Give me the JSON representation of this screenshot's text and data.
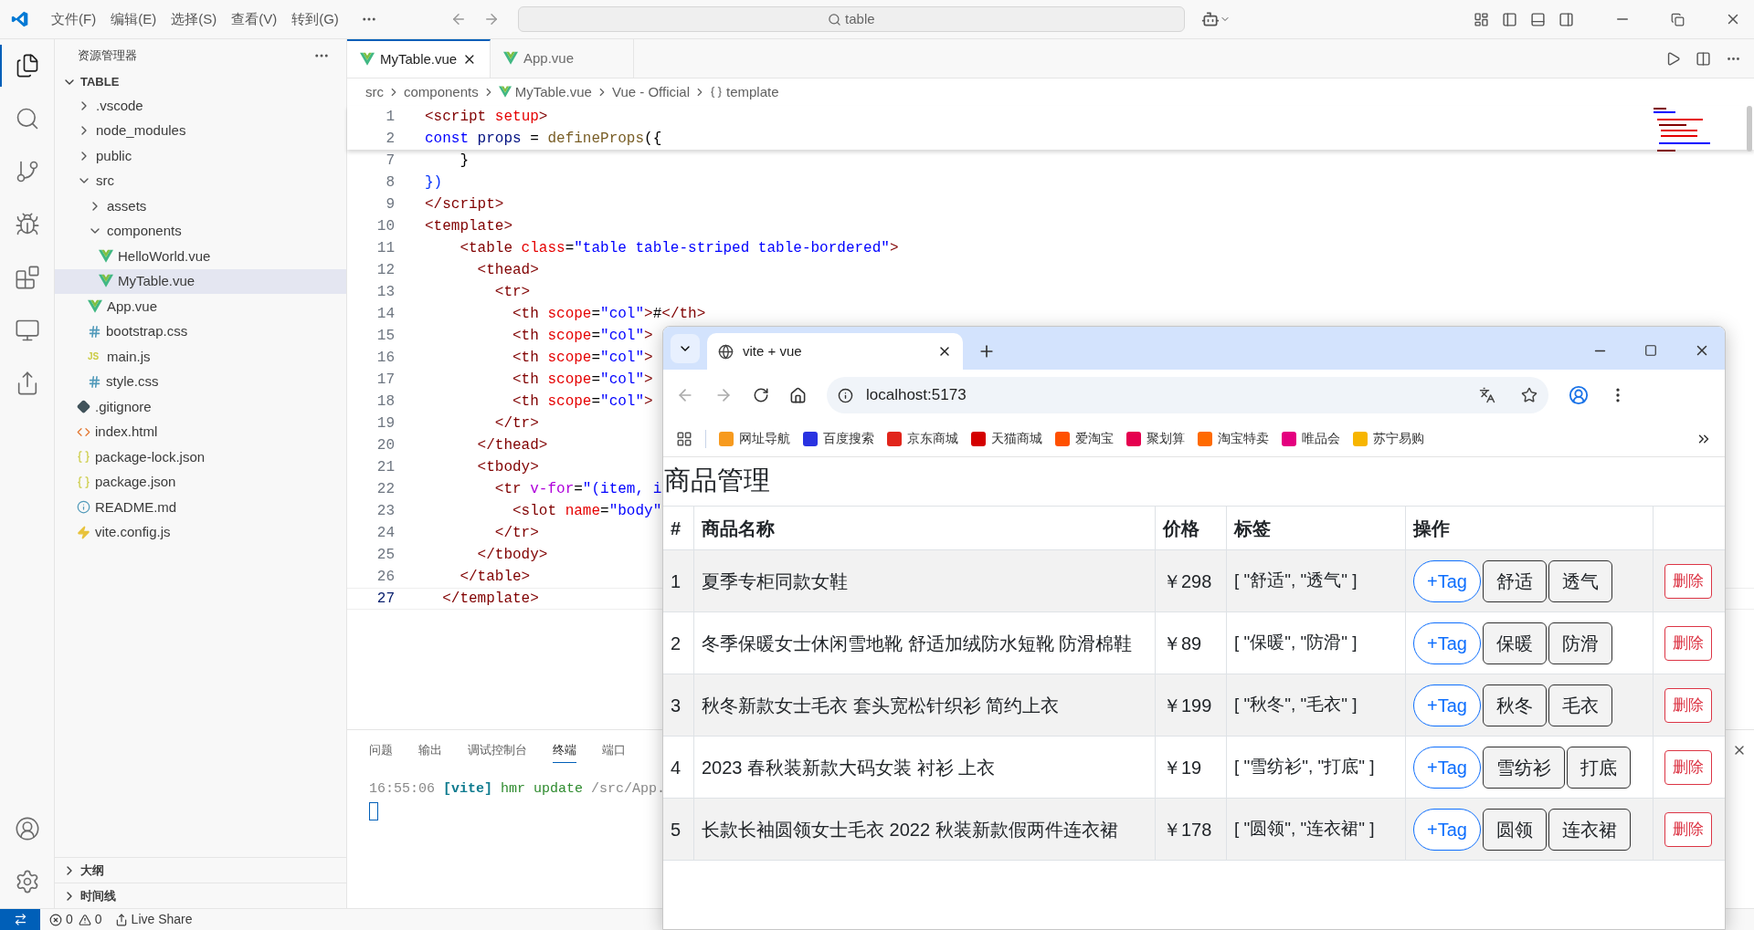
{
  "title_bar": {
    "menus": [
      "文件(F)",
      "编辑(E)",
      "选择(S)",
      "查看(V)",
      "转到(G)"
    ],
    "search": {
      "value": "table"
    }
  },
  "activity_bar": {
    "top": [
      {
        "kind": "explorer",
        "selected": true
      },
      {
        "kind": "search",
        "selected": false
      },
      {
        "kind": "scm",
        "selected": false
      },
      {
        "kind": "debug",
        "selected": false
      },
      {
        "kind": "extensions",
        "selected": false
      },
      {
        "kind": "remote",
        "selected": false
      },
      {
        "kind": "liveshare",
        "selected": false
      }
    ],
    "bottom": [
      {
        "kind": "account",
        "selected": false
      },
      {
        "kind": "manage",
        "selected": false
      }
    ]
  },
  "sidebar": {
    "title": "资源管理器",
    "tree": {
      "label": "TABLE",
      "expanded": true,
      "children": [
        {
          "label": ".vscode",
          "kind": "folder",
          "expanded": false,
          "selected": false
        },
        {
          "label": "node_modules",
          "kind": "folder",
          "expanded": false,
          "selected": false
        },
        {
          "label": "public",
          "kind": "folder",
          "expanded": false,
          "selected": false
        },
        {
          "label": "src",
          "kind": "folder",
          "expanded": true,
          "selected": false,
          "children": [
            {
              "label": "assets",
              "kind": "folder",
              "expanded": false,
              "selected": false
            },
            {
              "label": "components",
              "kind": "folder",
              "expanded": true,
              "selected": false,
              "children": [
                {
                  "label": "HelloWorld.vue",
                  "kind": "vue",
                  "selected": false
                },
                {
                  "label": "MyTable.vue",
                  "kind": "vue",
                  "selected": true
                }
              ]
            },
            {
              "label": "App.vue",
              "kind": "vue",
              "selected": false
            },
            {
              "label": "bootstrap.css",
              "kind": "css",
              "selected": false
            },
            {
              "label": "main.js",
              "kind": "js",
              "icon_text": "JS",
              "selected": false
            },
            {
              "label": "style.css",
              "kind": "css",
              "selected": false
            }
          ]
        },
        {
          "label": ".gitignore",
          "kind": "git",
          "selected": false
        },
        {
          "label": "index.html",
          "kind": "html",
          "selected": false
        },
        {
          "label": "package-lock.json",
          "kind": "json",
          "selected": false
        },
        {
          "label": "package.json",
          "kind": "json",
          "selected": false
        },
        {
          "label": "README.md",
          "kind": "info",
          "selected": false
        },
        {
          "label": "vite.config.js",
          "kind": "vite",
          "selected": false
        }
      ]
    },
    "sections": [
      {
        "label": "大纲",
        "expanded": false
      },
      {
        "label": "时间线",
        "expanded": false
      }
    ]
  },
  "editor": {
    "tabs": [
      {
        "label": "MyTable.vue",
        "selected": true
      },
      {
        "label": "App.vue",
        "selected": false
      }
    ],
    "breadcrumb": [
      {
        "text": "src",
        "kind": "plain"
      },
      {
        "text": "components",
        "kind": "plain"
      },
      {
        "text": "MyTable.vue",
        "kind": "vue"
      },
      {
        "text": "Vue - Official",
        "kind": "plain"
      },
      {
        "text": "template",
        "kind": "symbol"
      }
    ],
    "sticky_lines": [
      {
        "number": "1",
        "current": false,
        "tokens": [
          {
            "kind": "tag",
            "text": "<script"
          },
          {
            "kind": "attr",
            "text": " setup"
          },
          {
            "kind": "tag",
            "text": ">"
          }
        ]
      },
      {
        "number": "2",
        "current": false,
        "tokens": [
          {
            "kind": "kw",
            "text": "const"
          },
          {
            "kind": "var",
            "text": " props"
          },
          {
            "kind": "plain",
            "text": " = "
          },
          {
            "kind": "fn",
            "text": "defineProps"
          },
          {
            "kind": "plain",
            "text": "({"
          }
        ]
      }
    ],
    "lines": [
      {
        "number": "7",
        "current": false,
        "tokens": [
          {
            "kind": "plain",
            "text": "    }"
          }
        ]
      },
      {
        "number": "8",
        "current": false,
        "tokens": [
          {
            "kind": "bracket",
            "text": "})"
          }
        ]
      },
      {
        "number": "9",
        "current": false,
        "tokens": [
          {
            "kind": "tag",
            "text": "</script>"
          }
        ]
      },
      {
        "number": "10",
        "current": false,
        "tokens": [
          {
            "kind": "tag",
            "text": "<template>"
          }
        ]
      },
      {
        "number": "11",
        "current": false,
        "tokens": [
          {
            "kind": "tag",
            "text": "    <table"
          },
          {
            "kind": "attr",
            "text": " class"
          },
          {
            "kind": "plain",
            "text": "="
          },
          {
            "kind": "str",
            "text": "\"table table-striped table-bordered\""
          },
          {
            "kind": "tag",
            "text": ">"
          }
        ]
      },
      {
        "number": "12",
        "current": false,
        "tokens": [
          {
            "kind": "tag",
            "text": "      <thead>"
          }
        ]
      },
      {
        "number": "13",
        "current": false,
        "tokens": [
          {
            "kind": "tag",
            "text": "        <tr>"
          }
        ]
      },
      {
        "number": "14",
        "current": false,
        "tokens": [
          {
            "kind": "tag",
            "text": "          <th"
          },
          {
            "kind": "attr",
            "text": " scope"
          },
          {
            "kind": "plain",
            "text": "="
          },
          {
            "kind": "str",
            "text": "\"col\""
          },
          {
            "kind": "tag",
            "text": ">"
          },
          {
            "kind": "plain",
            "text": "#"
          },
          {
            "kind": "tag",
            "text": "</th>"
          }
        ]
      },
      {
        "number": "15",
        "current": false,
        "tokens": [
          {
            "kind": "tag",
            "text": "          <th"
          },
          {
            "kind": "attr",
            "text": " scope"
          },
          {
            "kind": "plain",
            "text": "="
          },
          {
            "kind": "str",
            "text": "\"col\""
          },
          {
            "kind": "tag",
            "text": ">"
          }
        ]
      },
      {
        "number": "16",
        "current": false,
        "tokens": [
          {
            "kind": "tag",
            "text": "          <th"
          },
          {
            "kind": "attr",
            "text": " scope"
          },
          {
            "kind": "plain",
            "text": "="
          },
          {
            "kind": "str",
            "text": "\"col\""
          },
          {
            "kind": "tag",
            "text": ">"
          }
        ]
      },
      {
        "number": "17",
        "current": false,
        "tokens": [
          {
            "kind": "tag",
            "text": "          <th"
          },
          {
            "kind": "attr",
            "text": " scope"
          },
          {
            "kind": "plain",
            "text": "="
          },
          {
            "kind": "str",
            "text": "\"col\""
          },
          {
            "kind": "tag",
            "text": ">"
          }
        ]
      },
      {
        "number": "18",
        "current": false,
        "tokens": [
          {
            "kind": "tag",
            "text": "          <th"
          },
          {
            "kind": "attr",
            "text": " scope"
          },
          {
            "kind": "plain",
            "text": "="
          },
          {
            "kind": "str",
            "text": "\"col\""
          },
          {
            "kind": "tag",
            "text": ">"
          }
        ]
      },
      {
        "number": "19",
        "current": false,
        "tokens": [
          {
            "kind": "tag",
            "text": "        </tr>"
          }
        ]
      },
      {
        "number": "20",
        "current": false,
        "tokens": [
          {
            "kind": "tag",
            "text": "      </thead>"
          }
        ]
      },
      {
        "number": "21",
        "current": false,
        "tokens": [
          {
            "kind": "tag",
            "text": "      <tbody>"
          }
        ]
      },
      {
        "number": "22",
        "current": false,
        "tokens": [
          {
            "kind": "tag",
            "text": "        <tr"
          },
          {
            "kind": "directive",
            "text": " v-for"
          },
          {
            "kind": "plain",
            "text": "="
          },
          {
            "kind": "str",
            "text": "\"(item, i"
          }
        ]
      },
      {
        "number": "23",
        "current": false,
        "tokens": [
          {
            "kind": "tag",
            "text": "          <slot"
          },
          {
            "kind": "attr",
            "text": " name"
          },
          {
            "kind": "plain",
            "text": "="
          },
          {
            "kind": "str",
            "text": "\"body\""
          }
        ]
      },
      {
        "number": "24",
        "current": false,
        "tokens": [
          {
            "kind": "tag",
            "text": "        </tr>"
          }
        ]
      },
      {
        "number": "25",
        "current": false,
        "tokens": [
          {
            "kind": "tag",
            "text": "      </tbody>"
          }
        ]
      },
      {
        "number": "26",
        "current": false,
        "tokens": [
          {
            "kind": "tag",
            "text": "    </table>"
          }
        ]
      },
      {
        "number": "27",
        "current": true,
        "tokens": [
          {
            "kind": "tag",
            "text": "  </template>"
          }
        ]
      }
    ]
  },
  "panel": {
    "tabs": [
      {
        "label": "问题",
        "selected": false
      },
      {
        "label": "输出",
        "selected": false
      },
      {
        "label": "调试控制台",
        "selected": false
      },
      {
        "label": "终端",
        "selected": true
      },
      {
        "label": "端口",
        "selected": false
      }
    ],
    "terminal": [
      {
        "kind": "time",
        "text": "16:55:06 "
      },
      {
        "kind": "tag",
        "text": "[vite]"
      },
      {
        "kind": "msg",
        "text": " hmr update "
      },
      {
        "kind": "time",
        "text": "/src/App."
      }
    ]
  },
  "status_bar": {
    "errors": "0",
    "warnings": "0",
    "live_share": "Live Share"
  },
  "browser": {
    "tab_title": "vite + vue",
    "url": "localhost:5173",
    "bookmarks": [
      {
        "label": "网址导航",
        "color": "#f79a1e"
      },
      {
        "label": "百度搜索",
        "color": "#2932e1"
      },
      {
        "label": "京东商城",
        "color": "#e1251b"
      },
      {
        "label": "天猫商城",
        "color": "#d40000"
      },
      {
        "label": "爱淘宝",
        "color": "#ff5000"
      },
      {
        "label": "聚划算",
        "color": "#e5004f"
      },
      {
        "label": "淘宝特卖",
        "color": "#ff6a00"
      },
      {
        "label": "唯品会",
        "color": "#e4007f"
      },
      {
        "label": "苏宁易购",
        "color": "#f7b500"
      }
    ],
    "page": {
      "heading": "商品管理",
      "table": {
        "columns": [
          "#",
          "商品名称",
          "价格",
          "标签",
          "操作"
        ],
        "rows": [
          {
            "index": "1",
            "name": "夏季专柜同款女鞋",
            "price": "￥298",
            "tags_text": "[ \"舒适\", \"透气\" ]",
            "add_button": "+Tag",
            "tags": [
              "舒适",
              "透气"
            ],
            "delete": "删除"
          },
          {
            "index": "2",
            "name": "冬季保暖女士休闲雪地靴 舒适加绒防水短靴 防滑棉鞋",
            "price": "￥89",
            "tags_text": "[ \"保暖\", \"防滑\" ]",
            "add_button": "+Tag",
            "tags": [
              "保暖",
              "防滑"
            ],
            "delete": "删除"
          },
          {
            "index": "3",
            "name": "秋冬新款女士毛衣 套头宽松针织衫 简约上衣",
            "price": "￥199",
            "tags_text": "[ \"秋冬\", \"毛衣\" ]",
            "add_button": "+Tag",
            "tags": [
              "秋冬",
              "毛衣"
            ],
            "delete": "删除"
          },
          {
            "index": "4",
            "name": "2023 春秋装新款大码女装 衬衫 上衣",
            "price": "￥19",
            "tags_text": "[ \"雪纺衫\", \"打底\" ]",
            "add_button": "+Tag",
            "tags": [
              "雪纺衫",
              "打底"
            ],
            "delete": "删除"
          },
          {
            "index": "5",
            "name": "长款长袖圆领女士毛衣 2022 秋装新款假两件连衣裙",
            "price": "￥178",
            "tags_text": "[ \"圆领\", \"连衣裙\" ]",
            "add_button": "+Tag",
            "tags": [
              "圆领",
              "连衣裙"
            ],
            "delete": "删除"
          }
        ]
      }
    }
  }
}
